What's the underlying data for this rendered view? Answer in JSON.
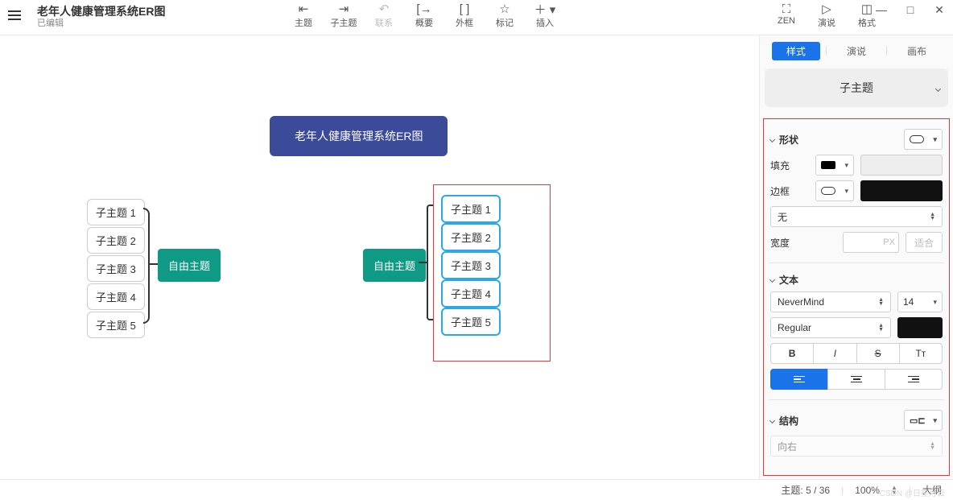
{
  "header": {
    "title": "老年人健康管理系统ER图",
    "subtitle": "已编辑",
    "tools": [
      {
        "icon": "⇤",
        "label": "主题"
      },
      {
        "icon": "⇥",
        "label": "子主题"
      },
      {
        "icon": "↶",
        "label": "联系",
        "disabled": true
      },
      {
        "icon": "[→",
        "label": "概要"
      },
      {
        "icon": "[ ]",
        "label": "外框"
      },
      {
        "icon": "☆",
        "label": "标记"
      },
      {
        "icon": "＋ ▾",
        "label": "插入"
      }
    ],
    "tools_right": [
      {
        "icon": "⛶",
        "label": "ZEN"
      },
      {
        "icon": "▷",
        "label": "演说"
      },
      {
        "icon": "◫",
        "label": "格式"
      }
    ],
    "window": {
      "min": "—",
      "max": "□",
      "close": "✕"
    }
  },
  "canvas": {
    "root": "老年人健康管理系统ER图",
    "free1": {
      "label": "自由主题",
      "children": [
        "子主题 1",
        "子主题 2",
        "子主题 3",
        "子主题 4",
        "子主题 5"
      ]
    },
    "free2": {
      "label": "自由主题",
      "children": [
        "子主题 1",
        "子主题 2",
        "子主题 3",
        "子主题 4",
        "子主题 5"
      ]
    }
  },
  "panel": {
    "tabs": {
      "style": "样式",
      "pitch": "演说",
      "canvas": "画布"
    },
    "preview": "子主题",
    "shape": {
      "title": "形状",
      "fill": "填充",
      "border": "边框",
      "none": "无",
      "width": "宽度",
      "px": "PX",
      "fit": "适合"
    },
    "text": {
      "title": "文本",
      "font": "NeverMind",
      "size": "14",
      "weight": "Regular"
    },
    "align": [
      "B",
      "I",
      "S",
      "Tᴛ"
    ],
    "structure": {
      "title": "结构",
      "value": "向右"
    }
  },
  "footer": {
    "topic": "主题: 5 / 36",
    "zoom": "100%",
    "outline": "大纲"
  },
  "watermark": "CSDN @日星月云"
}
